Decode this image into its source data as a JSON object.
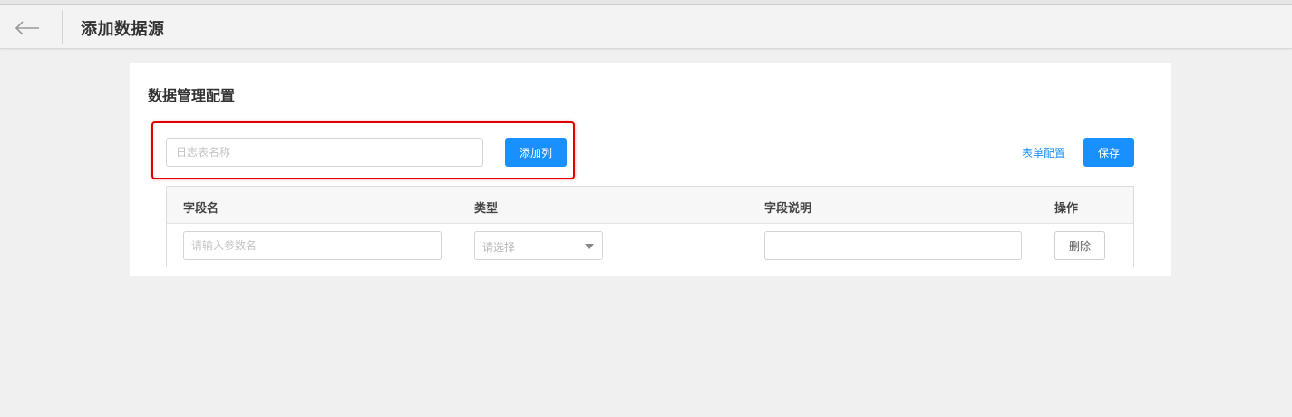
{
  "header": {
    "title": "添加数据源"
  },
  "config": {
    "title": "数据管理配置",
    "log_table_placeholder": "日志表名称",
    "add_column_label": "添加列",
    "form_config_label": "表单配置",
    "save_label": "保存"
  },
  "table": {
    "columns": [
      "字段名",
      "类型",
      "字段说明",
      "操作"
    ],
    "row": {
      "field_name_placeholder": "请输入参数名",
      "type_placeholder": "请选择",
      "description_value": "",
      "delete_label": "删除"
    }
  },
  "colors": {
    "primary": "#1890ff",
    "highlight": "#e10000"
  },
  "icons": {
    "back": "arrow-left-icon",
    "dropdown": "caret-down-icon"
  }
}
